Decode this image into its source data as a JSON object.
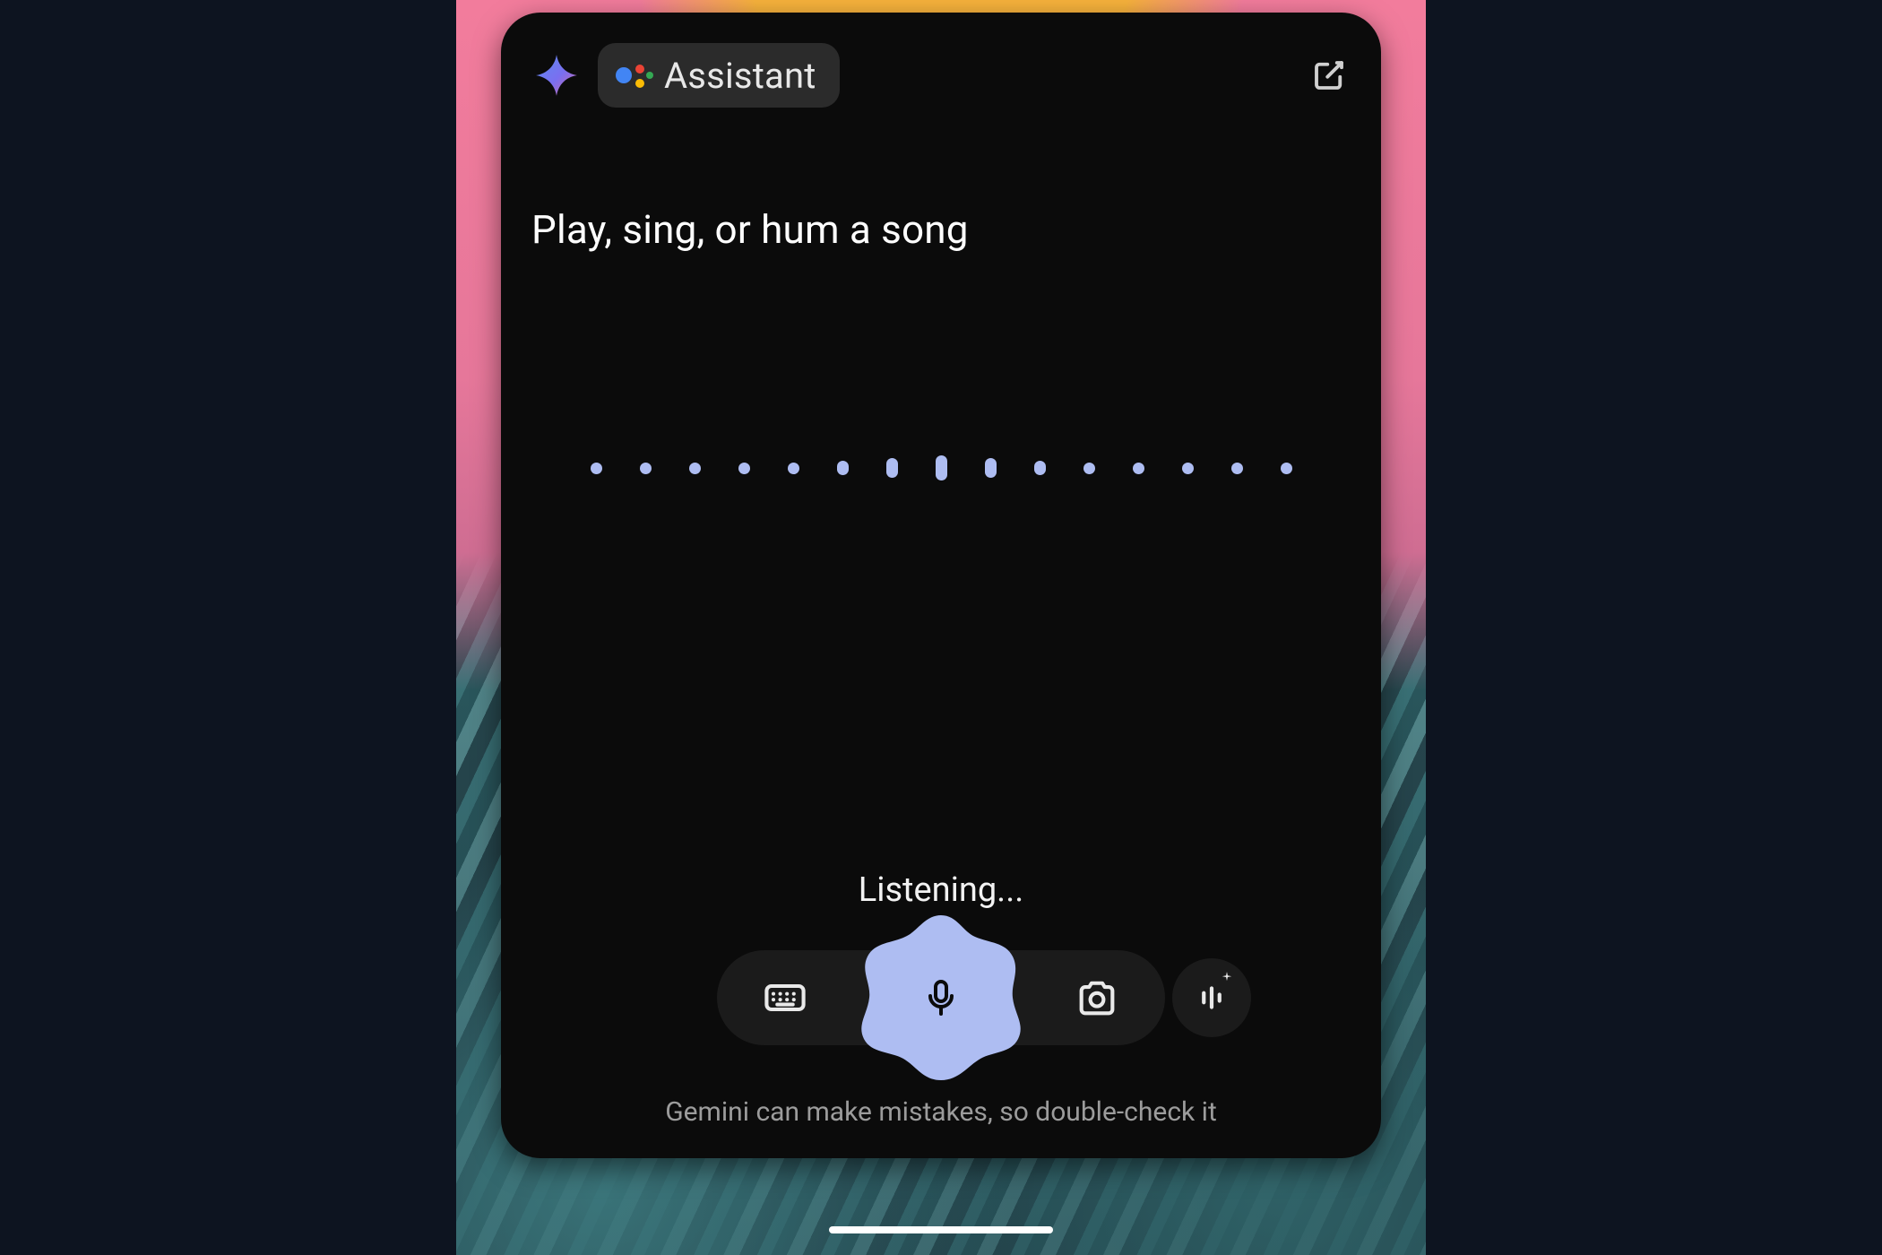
{
  "header": {
    "chip_label": "Assistant"
  },
  "prompt_text": "Play, sing, or hum a song",
  "status_text": "Listening...",
  "disclaimer_text": "Gemini can make mistakes, so double-check it",
  "colors": {
    "blob": "#aebdf2",
    "wave_dot": "#aebdf2"
  },
  "waveform_heights": [
    1,
    1,
    1,
    1,
    1,
    2,
    3,
    4,
    3,
    2,
    1,
    1,
    1,
    1,
    1
  ]
}
